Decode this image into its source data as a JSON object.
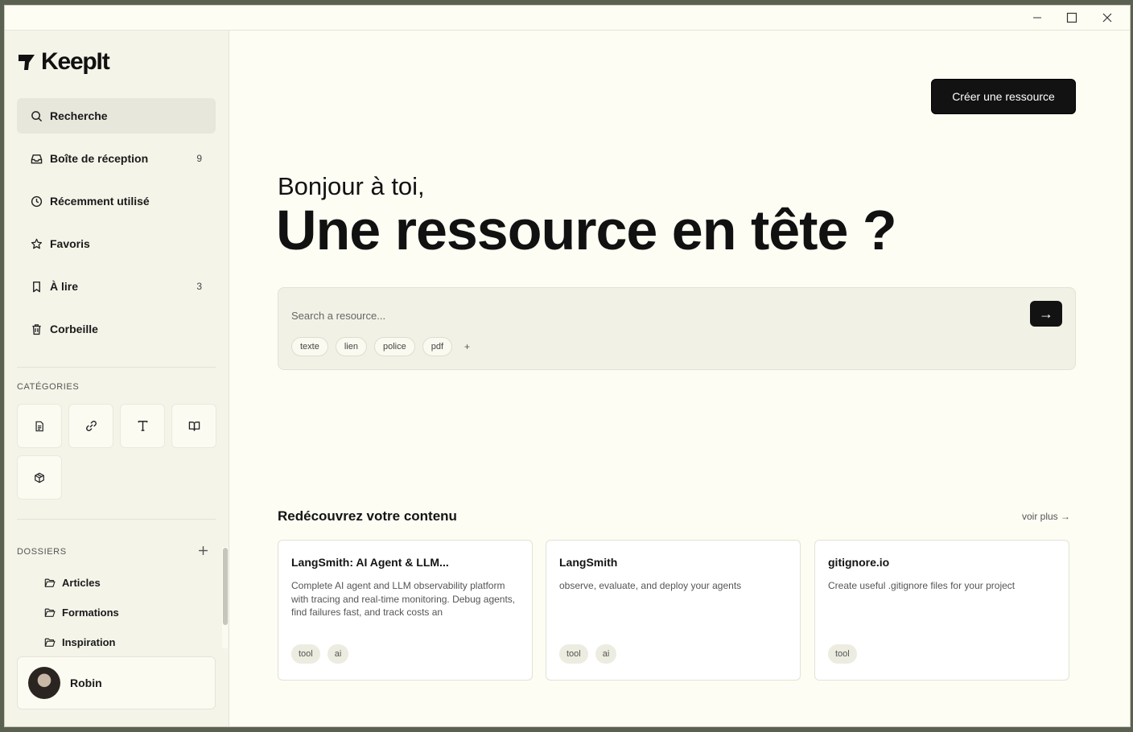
{
  "titlebar": {
    "minimize": "minimize",
    "maximize": "maximize",
    "close": "close"
  },
  "sidebar": {
    "logo_text": "KeepIt",
    "nav": [
      {
        "label": "Recherche",
        "icon": "search-icon",
        "count": ""
      },
      {
        "label": "Boîte de réception",
        "icon": "inbox-icon",
        "count": "9"
      },
      {
        "label": "Récemment utilisé",
        "icon": "clock-icon",
        "count": ""
      },
      {
        "label": "Favoris",
        "icon": "star-icon",
        "count": ""
      },
      {
        "label": "À lire",
        "icon": "bookmark-icon",
        "count": "3"
      },
      {
        "label": "Corbeille",
        "icon": "trash-icon",
        "count": ""
      }
    ],
    "categories_label": "CATÉGORIES",
    "categories": [
      {
        "icon": "document-icon"
      },
      {
        "icon": "link-icon"
      },
      {
        "icon": "text-icon"
      },
      {
        "icon": "book-icon"
      },
      {
        "icon": "package-icon"
      }
    ],
    "folders_label": "DOSSIERS",
    "folders": [
      {
        "label": "Articles"
      },
      {
        "label": "Formations"
      },
      {
        "label": "Inspiration"
      }
    ],
    "user": {
      "name": "Robin"
    }
  },
  "main": {
    "create_button": "Créer une ressource",
    "greeting": "Bonjour à toi,",
    "headline": {
      "before": "Une ",
      "bold": "ressource",
      "after": " en tête ?"
    },
    "search": {
      "placeholder": "Search a resource...",
      "value": "",
      "submit_label": "→",
      "chips": [
        "texte",
        "lien",
        "police",
        "pdf"
      ],
      "add_chip": "+"
    },
    "rediscover": {
      "title": "Redécouvrez votre contenu",
      "see_more": "voir plus →",
      "cards": [
        {
          "title": "LangSmith: AI Agent & LLM...",
          "description": "Complete AI agent and LLM observability platform with tracing and real-time monitoring. Debug agents, find failures fast, and track costs an",
          "tags": [
            "tool",
            "ai"
          ]
        },
        {
          "title": "LangSmith",
          "description": "observe, evaluate, and deploy your agents",
          "tags": [
            "tool",
            "ai"
          ]
        },
        {
          "title": "gitignore.io",
          "description": "Create useful .gitignore files for your project",
          "tags": [
            "tool"
          ]
        }
      ]
    }
  }
}
